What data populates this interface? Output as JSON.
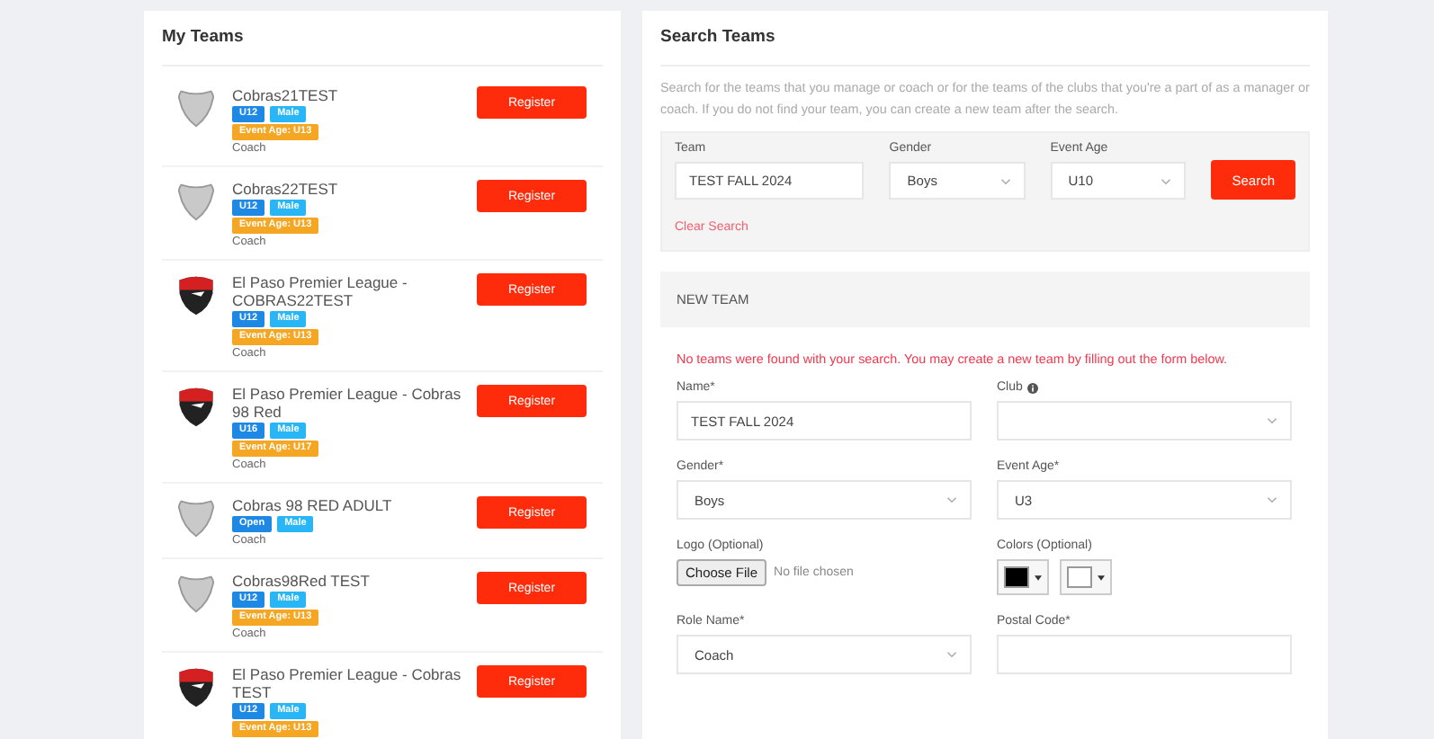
{
  "my_teams": {
    "title": "My Teams",
    "teams": [
      {
        "kind": "shield",
        "name": "Cobras21TEST",
        "tags": [
          {
            "label": "U12",
            "color": "#1e88e5"
          },
          {
            "label": "Male",
            "color": "#29b6f6"
          }
        ],
        "event_age": "Event Age: U13",
        "role": "Coach",
        "button": "Register"
      },
      {
        "kind": "shield",
        "name": "Cobras22TEST",
        "tags": [
          {
            "label": "U12",
            "color": "#1e88e5"
          },
          {
            "label": "Male",
            "color": "#29b6f6"
          }
        ],
        "event_age": "Event Age: U13",
        "role": "Coach",
        "button": "Register"
      },
      {
        "kind": "crest",
        "name": "El Paso Premier League - COBRAS22TEST",
        "tags": [
          {
            "label": "U12",
            "color": "#1e88e5"
          },
          {
            "label": "Male",
            "color": "#29b6f6"
          }
        ],
        "event_age": "Event Age: U13",
        "role": "Coach",
        "button": "Register"
      },
      {
        "kind": "crest",
        "name": "El Paso Premier League - Cobras 98 Red",
        "tags": [
          {
            "label": "U16",
            "color": "#1e88e5"
          },
          {
            "label": "Male",
            "color": "#29b6f6"
          }
        ],
        "event_age": "Event Age: U17",
        "role": "Coach",
        "button": "Register"
      },
      {
        "kind": "shield",
        "name": "Cobras 98 RED ADULT",
        "tags": [
          {
            "label": "Open",
            "color": "#1e88e5"
          },
          {
            "label": "Male",
            "color": "#29b6f6"
          }
        ],
        "role": "Coach",
        "button": "Register"
      },
      {
        "kind": "shield",
        "name": "Cobras98Red TEST",
        "tags": [
          {
            "label": "U12",
            "color": "#1e88e5"
          },
          {
            "label": "Male",
            "color": "#29b6f6"
          }
        ],
        "event_age": "Event Age: U13",
        "role": "Coach",
        "button": "Register"
      },
      {
        "kind": "crest",
        "name": "El Paso Premier League - Cobras TEST",
        "tags": [
          {
            "label": "U12",
            "color": "#1e88e5"
          },
          {
            "label": "Male",
            "color": "#29b6f6"
          }
        ],
        "event_age": "Event Age: U13",
        "button": "Register"
      }
    ]
  },
  "search_teams": {
    "title": "Search Teams",
    "description": "Search for the teams that you manage or coach or for the teams of the clubs that you're a part of as a manager or coach. If you do not find your team, you can create a new team after the search.",
    "team": {
      "label": "Team",
      "value": "TEST FALL 2024"
    },
    "gender": {
      "label": "Gender",
      "value": "Boys"
    },
    "event_age": {
      "label": "Event Age",
      "value": "U10"
    },
    "search_button": "Search",
    "clear_link": "Clear Search"
  },
  "new_team": {
    "title": "NEW TEAM",
    "message": "No teams were found with your search. You may create a new team by filling out the form below.",
    "name": {
      "label": "Name*",
      "value": "TEST FALL 2024"
    },
    "club": {
      "label": "Club"
    },
    "gender": {
      "label": "Gender*",
      "value": "Boys"
    },
    "event_age": {
      "label": "Event Age*",
      "value": "U3"
    },
    "logo": {
      "label": "Logo (Optional)",
      "button": "Choose File",
      "status": "No file chosen"
    },
    "colors": {
      "label": "Colors (Optional)",
      "swatches": [
        {
          "color": "#000000"
        },
        {
          "color": "#ffffff"
        }
      ]
    },
    "role_name": {
      "label": "Role Name*",
      "value": "Coach"
    },
    "postal_code": {
      "label": "Postal Code*"
    }
  }
}
